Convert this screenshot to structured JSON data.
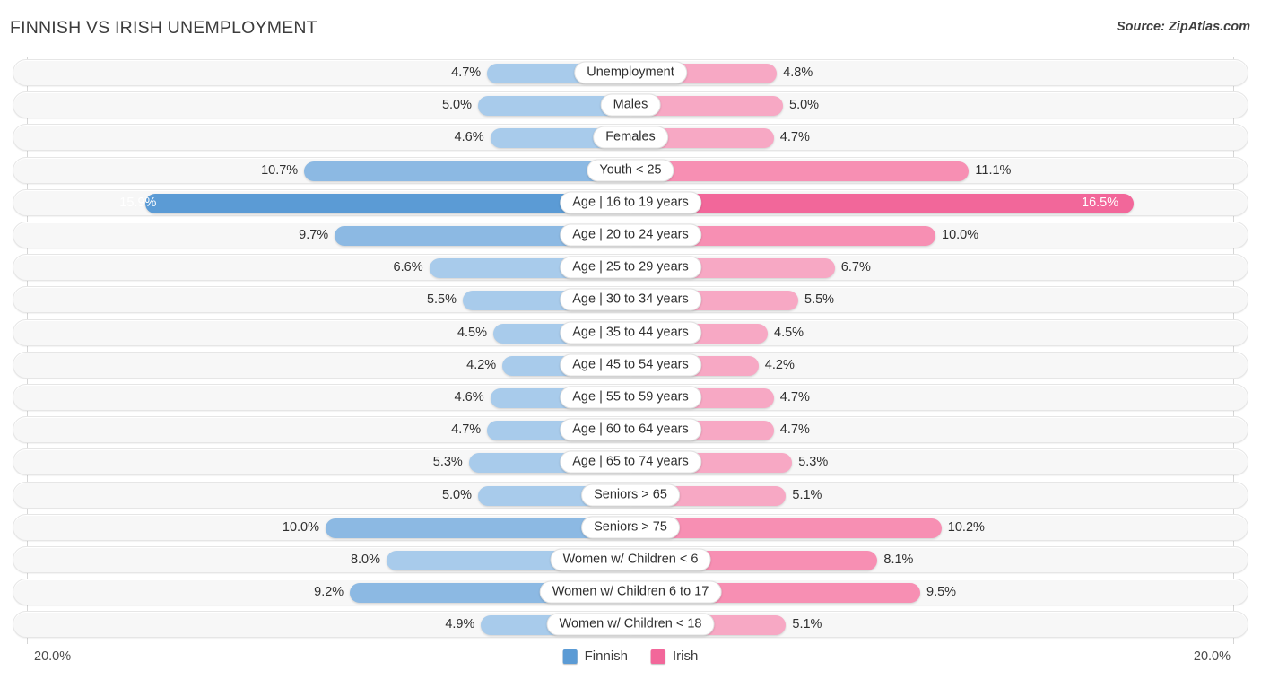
{
  "header": {
    "title": "FINNISH VS IRISH UNEMPLOYMENT",
    "source": "Source: ZipAtlas.com"
  },
  "footer": {
    "axis_max_left": "20.0%",
    "axis_max_right": "20.0%",
    "legend": [
      {
        "label": "Finnish",
        "color": "#5b9bd5"
      },
      {
        "label": "Irish",
        "color": "#f2679a"
      }
    ]
  },
  "colors": {
    "left_light": "#a8cbeb",
    "left_mid": "#8cb9e3",
    "left_dark": "#5b9bd5",
    "right_light": "#f7a8c4",
    "right_mid": "#f78fb3",
    "right_dark": "#f2679a",
    "track": "#f7f7f7",
    "track_border": "#e6e6e6"
  },
  "chart_data": {
    "type": "bar",
    "subtype": "diverging-bidirectional",
    "title": "FINNISH VS IRISH UNEMPLOYMENT",
    "xlabel": "",
    "ylabel": "",
    "axis_max": 20.0,
    "units": "%",
    "grid": false,
    "legend_position": "bottom-center",
    "series": [
      {
        "name": "Finnish",
        "side": "left",
        "color": "#5b9bd5",
        "values": [
          4.7,
          5.0,
          4.6,
          10.7,
          15.9,
          9.7,
          6.6,
          5.5,
          4.5,
          4.2,
          4.6,
          4.7,
          5.3,
          5.0,
          10.0,
          8.0,
          9.2,
          4.9
        ]
      },
      {
        "name": "Irish",
        "side": "right",
        "color": "#f2679a",
        "values": [
          4.8,
          5.0,
          4.7,
          11.1,
          16.5,
          10.0,
          6.7,
          5.5,
          4.5,
          4.2,
          4.7,
          4.7,
          5.3,
          5.1,
          10.2,
          8.1,
          9.5,
          5.1
        ]
      }
    ],
    "categories": [
      "Unemployment",
      "Males",
      "Females",
      "Youth < 25",
      "Age | 16 to 19 years",
      "Age | 20 to 24 years",
      "Age | 25 to 29 years",
      "Age | 30 to 34 years",
      "Age | 35 to 44 years",
      "Age | 45 to 54 years",
      "Age | 55 to 59 years",
      "Age | 60 to 64 years",
      "Age | 65 to 74 years",
      "Seniors > 65",
      "Seniors > 75",
      "Women w/ Children < 6",
      "Women w/ Children 6 to 17",
      "Women w/ Children < 18"
    ],
    "rows": [
      {
        "label": "Unemployment",
        "left_value": 4.7,
        "left_text": "4.7%",
        "right_value": 4.8,
        "right_text": "4.8%",
        "highlight": false
      },
      {
        "label": "Males",
        "left_value": 5.0,
        "left_text": "5.0%",
        "right_value": 5.0,
        "right_text": "5.0%",
        "highlight": false
      },
      {
        "label": "Females",
        "left_value": 4.6,
        "left_text": "4.6%",
        "right_value": 4.7,
        "right_text": "4.7%",
        "highlight": false
      },
      {
        "label": "Youth < 25",
        "left_value": 10.7,
        "left_text": "10.7%",
        "right_value": 11.1,
        "right_text": "11.1%",
        "highlight": false
      },
      {
        "label": "Age | 16 to 19 years",
        "left_value": 15.9,
        "left_text": "15.9%",
        "right_value": 16.5,
        "right_text": "16.5%",
        "highlight": true
      },
      {
        "label": "Age | 20 to 24 years",
        "left_value": 9.7,
        "left_text": "9.7%",
        "right_value": 10.0,
        "right_text": "10.0%",
        "highlight": false
      },
      {
        "label": "Age | 25 to 29 years",
        "left_value": 6.6,
        "left_text": "6.6%",
        "right_value": 6.7,
        "right_text": "6.7%",
        "highlight": false
      },
      {
        "label": "Age | 30 to 34 years",
        "left_value": 5.5,
        "left_text": "5.5%",
        "right_value": 5.5,
        "right_text": "5.5%",
        "highlight": false
      },
      {
        "label": "Age | 35 to 44 years",
        "left_value": 4.5,
        "left_text": "4.5%",
        "right_value": 4.5,
        "right_text": "4.5%",
        "highlight": false
      },
      {
        "label": "Age | 45 to 54 years",
        "left_value": 4.2,
        "left_text": "4.2%",
        "right_value": 4.2,
        "right_text": "4.2%",
        "highlight": false
      },
      {
        "label": "Age | 55 to 59 years",
        "left_value": 4.6,
        "left_text": "4.6%",
        "right_value": 4.7,
        "right_text": "4.7%",
        "highlight": false
      },
      {
        "label": "Age | 60 to 64 years",
        "left_value": 4.7,
        "left_text": "4.7%",
        "right_value": 4.7,
        "right_text": "4.7%",
        "highlight": false
      },
      {
        "label": "Age | 65 to 74 years",
        "left_value": 5.3,
        "left_text": "5.3%",
        "right_value": 5.3,
        "right_text": "5.3%",
        "highlight": false
      },
      {
        "label": "Seniors > 65",
        "left_value": 5.0,
        "left_text": "5.0%",
        "right_value": 5.1,
        "right_text": "5.1%",
        "highlight": false
      },
      {
        "label": "Seniors > 75",
        "left_value": 10.0,
        "left_text": "10.0%",
        "right_value": 10.2,
        "right_text": "10.2%",
        "highlight": false
      },
      {
        "label": "Women w/ Children < 6",
        "left_value": 8.0,
        "left_text": "8.0%",
        "right_value": 8.1,
        "right_text": "8.1%",
        "highlight": false
      },
      {
        "label": "Women w/ Children 6 to 17",
        "left_value": 9.2,
        "left_text": "9.2%",
        "right_value": 9.5,
        "right_text": "9.5%",
        "highlight": false
      },
      {
        "label": "Women w/ Children < 18",
        "left_value": 4.9,
        "left_text": "4.9%",
        "right_value": 5.1,
        "right_text": "5.1%",
        "highlight": false
      }
    ]
  }
}
